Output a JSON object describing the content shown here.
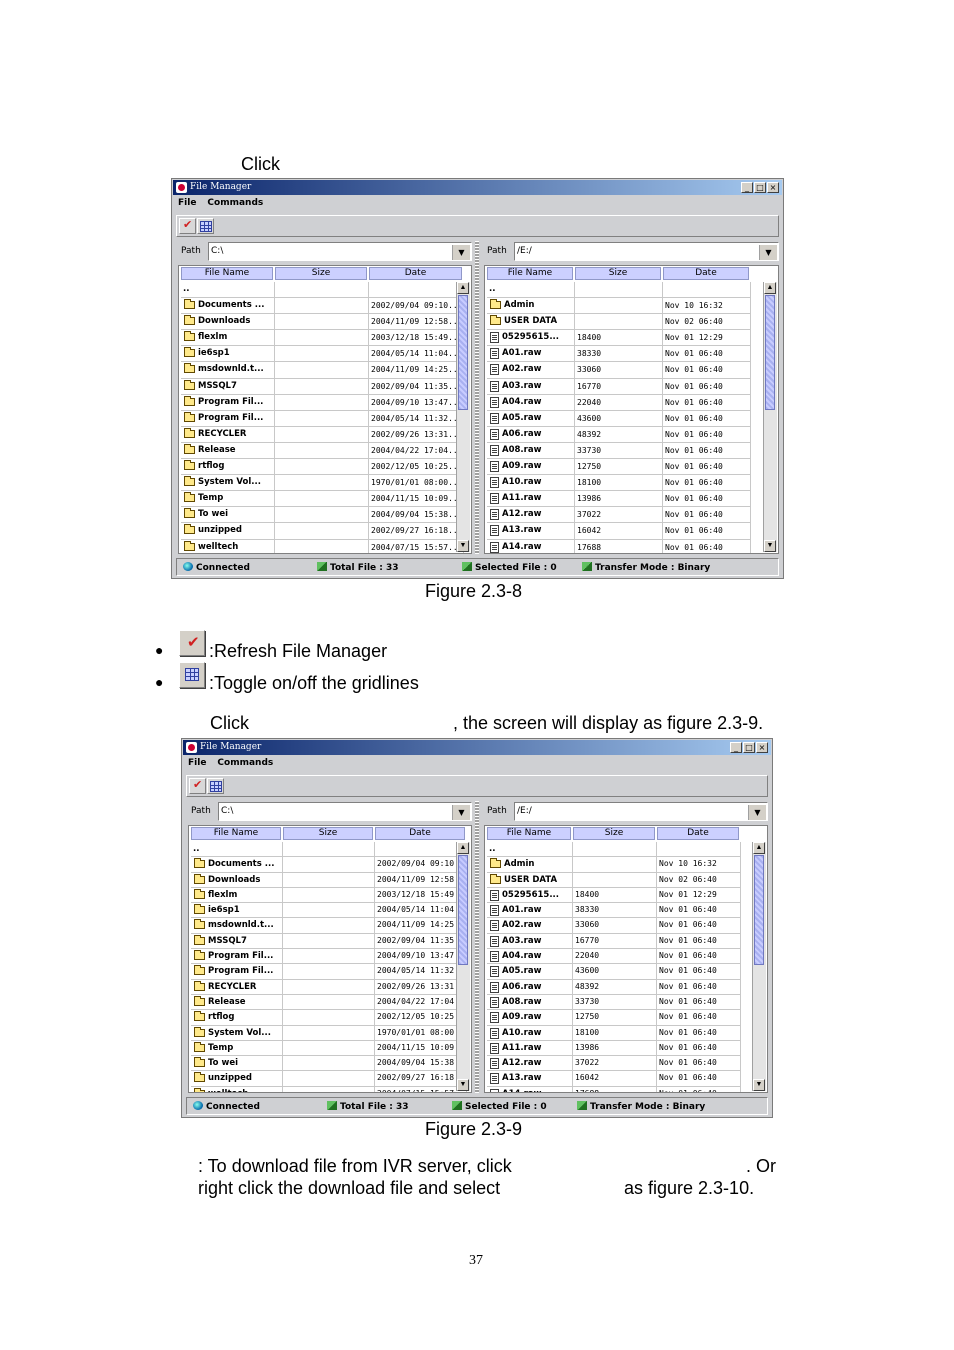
{
  "text": {
    "click1": "Click",
    "figure1": "Figure 2.3-8",
    "bullet1": ":Refresh File Manager",
    "bullet2": ":Toggle on/off the gridlines",
    "click2_a": "Click",
    "click2_b": ", the screen will display as figure 2.3-9.",
    "figure2": "Figure 2.3-9",
    "para_line1_a": ": To download file from IVR server, click",
    "para_line1_b": ". Or",
    "para_line2_a": "right click the download file and select",
    "para_line2_b": "as figure 2.3-10.",
    "page_number": "37"
  },
  "window": {
    "title": "File Manager",
    "menu": [
      "File",
      "Commands"
    ],
    "minimize_glyph": "_",
    "maximize_glyph": "□",
    "close_glyph": "×"
  },
  "local": {
    "path_label": "Path",
    "path_value": "C:\\",
    "headers": [
      "File Name",
      "Size",
      "Date"
    ],
    "rows": [
      {
        "name": "..",
        "size": "",
        "date": "",
        "icon": "none"
      },
      {
        "name": "Documents ...",
        "size": "",
        "date": "2002/09/04 09:10...",
        "icon": "folder"
      },
      {
        "name": "Downloads",
        "size": "",
        "date": "2004/11/09 12:58...",
        "icon": "folder"
      },
      {
        "name": "flexlm",
        "size": "",
        "date": "2003/12/18 15:49...",
        "icon": "folder"
      },
      {
        "name": "ie6sp1",
        "size": "",
        "date": "2004/05/14 11:04...",
        "icon": "folder"
      },
      {
        "name": "msdownld.t...",
        "size": "",
        "date": "2004/11/09 14:25...",
        "icon": "folder"
      },
      {
        "name": "MSSQL7",
        "size": "",
        "date": "2002/09/04 11:35...",
        "icon": "folder"
      },
      {
        "name": "Program Fil...",
        "size": "",
        "date": "2004/09/10 13:47...",
        "icon": "folder"
      },
      {
        "name": "Program Fil...",
        "size": "",
        "date": "2004/05/14 11:32...",
        "icon": "folder"
      },
      {
        "name": "RECYCLER",
        "size": "",
        "date": "2002/09/26 13:31...",
        "icon": "folder"
      },
      {
        "name": "Release",
        "size": "",
        "date": "2004/04/22 17:04...",
        "icon": "folder"
      },
      {
        "name": "rtflog",
        "size": "",
        "date": "2002/12/05 10:25...",
        "icon": "folder"
      },
      {
        "name": "System Vol...",
        "size": "",
        "date": "1970/01/01 08:00...",
        "icon": "folder"
      },
      {
        "name": "Temp",
        "size": "",
        "date": "2004/11/15 10:09...",
        "icon": "folder"
      },
      {
        "name": "To wei",
        "size": "",
        "date": "2004/09/04 15:38...",
        "icon": "folder"
      },
      {
        "name": "unzipped",
        "size": "",
        "date": "2002/09/27 16:18...",
        "icon": "folder"
      },
      {
        "name": "welltech",
        "size": "",
        "date": "2004/07/15 15:57...",
        "icon": "folder"
      }
    ]
  },
  "remote": {
    "path_label": "Path",
    "path_value": "/E:/",
    "headers": [
      "File Name",
      "Size",
      "Date"
    ],
    "rows": [
      {
        "name": "..",
        "size": "",
        "date": "",
        "icon": "none"
      },
      {
        "name": "Admin",
        "size": "",
        "date": "Nov 10 16:32",
        "icon": "folder"
      },
      {
        "name": "USER DATA",
        "size": "",
        "date": "Nov 02 06:40",
        "icon": "folder"
      },
      {
        "name": "05295615...",
        "size": "18400",
        "date": "Nov 01 12:29",
        "icon": "file"
      },
      {
        "name": "A01.raw",
        "size": "38330",
        "date": "Nov 01 06:40",
        "icon": "file"
      },
      {
        "name": "A02.raw",
        "size": "33060",
        "date": "Nov 01 06:40",
        "icon": "file"
      },
      {
        "name": "A03.raw",
        "size": "16770",
        "date": "Nov 01 06:40",
        "icon": "file"
      },
      {
        "name": "A04.raw",
        "size": "22040",
        "date": "Nov 01 06:40",
        "icon": "file"
      },
      {
        "name": "A05.raw",
        "size": "43600",
        "date": "Nov 01 06:40",
        "icon": "file"
      },
      {
        "name": "A06.raw",
        "size": "48392",
        "date": "Nov 01 06:40",
        "icon": "file"
      },
      {
        "name": "A08.raw",
        "size": "33730",
        "date": "Nov 01 06:40",
        "icon": "file"
      },
      {
        "name": "A09.raw",
        "size": "12750",
        "date": "Nov 01 06:40",
        "icon": "file"
      },
      {
        "name": "A10.raw",
        "size": "18100",
        "date": "Nov 01 06:40",
        "icon": "file"
      },
      {
        "name": "A11.raw",
        "size": "13986",
        "date": "Nov 01 06:40",
        "icon": "file"
      },
      {
        "name": "A12.raw",
        "size": "37022",
        "date": "Nov 01 06:40",
        "icon": "file"
      },
      {
        "name": "A13.raw",
        "size": "16042",
        "date": "Nov 01 06:40",
        "icon": "file"
      },
      {
        "name": "A14.raw",
        "size": "17688",
        "date": "Nov 01 06:40",
        "icon": "file"
      }
    ]
  },
  "status": {
    "connected": "Connected",
    "total": "Total File : 33",
    "selected": "Selected File : 0",
    "mode": "Transfer Mode : Binary"
  },
  "icons": {
    "refresh": "refresh-icon",
    "grid": "gridlines-icon",
    "folder": "folder-icon",
    "file": "file-icon"
  }
}
